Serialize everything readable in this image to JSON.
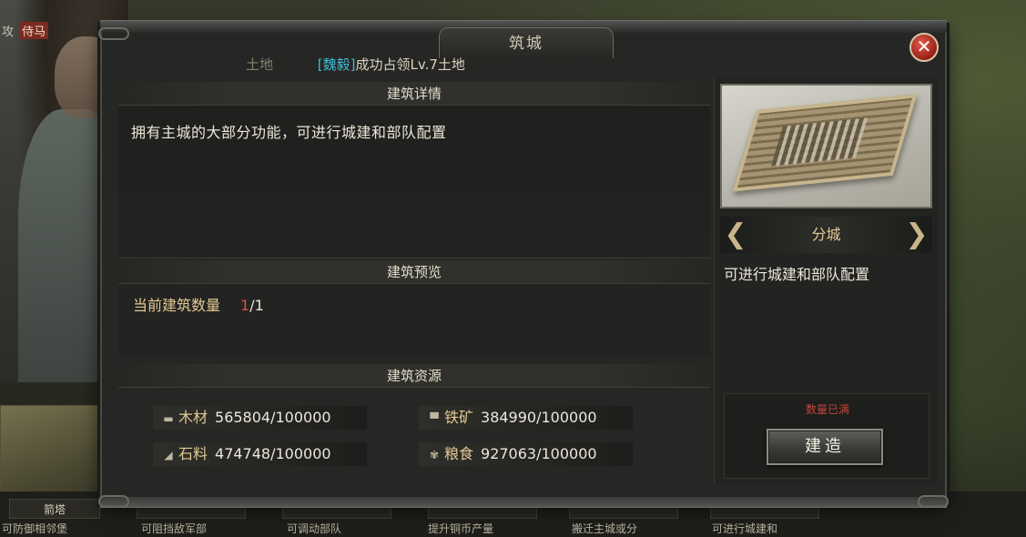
{
  "background": {
    "top_left_labels": [
      "攻",
      "侍马"
    ],
    "bottom_cards": [
      {
        "label": "箭塔",
        "desc": "可防御相邻堡"
      },
      {
        "label": "",
        "desc": "可阻挡敌军部"
      },
      {
        "label": "",
        "desc": "可调动部队"
      },
      {
        "label": "",
        "desc": "提升铜币产量"
      },
      {
        "label": "",
        "desc": "搬迁主城或分"
      },
      {
        "label": "",
        "desc": "可进行城建和"
      }
    ]
  },
  "dialog": {
    "title": "筑城",
    "close_symbol": "✕",
    "notice": {
      "prefix": "土地",
      "tag": "[魏毅]",
      "message": "成功占领Lv.7土地"
    }
  },
  "details": {
    "header": "建筑详情",
    "description": "拥有主城的大部分功能，可进行城建和部队配置"
  },
  "preview": {
    "header": "建筑预览",
    "count_label": "当前建筑数量",
    "count_current": "1",
    "count_max": "/1"
  },
  "resources": {
    "header": "建筑资源",
    "items": [
      {
        "icon": "wood-icon",
        "glyph": "▬",
        "name": "木材",
        "value": "565804/100000"
      },
      {
        "icon": "iron-icon",
        "glyph": "▀",
        "name": "铁矿",
        "value": "384990/100000"
      },
      {
        "icon": "stone-icon",
        "glyph": "◢",
        "name": "石料",
        "value": "474748/100000"
      },
      {
        "icon": "grain-icon",
        "glyph": "✾",
        "name": "粮食",
        "value": "927063/100000"
      }
    ]
  },
  "building": {
    "name": "分城",
    "description": "可进行城建和部队配置",
    "prev_symbol": "❮",
    "next_symbol": "❯",
    "status": "数量已满",
    "build_label": "建造"
  },
  "colors": {
    "tag": "#3fbcd6",
    "highlight_count": "#d8504a",
    "status_red": "#c2443b",
    "gold": "#e3c992"
  }
}
